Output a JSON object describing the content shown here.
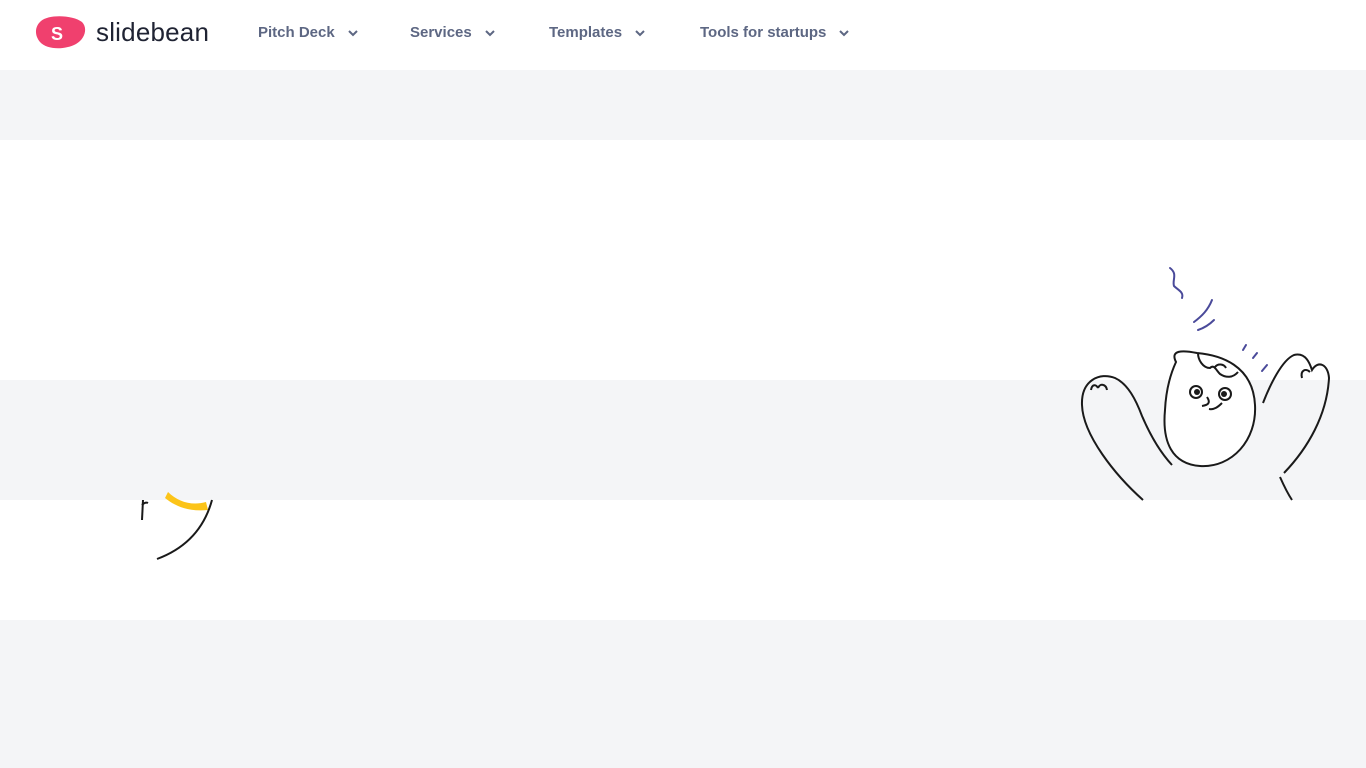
{
  "brand": {
    "name": "slidebean",
    "logo_letter": "S",
    "logo_color": "#f0406e"
  },
  "nav": {
    "items": [
      {
        "label": "Pitch Deck",
        "icon": "chevron-down-icon"
      },
      {
        "label": "Services",
        "icon": "chevron-down-icon"
      },
      {
        "label": "Templates",
        "icon": "chevron-down-icon"
      },
      {
        "label": "Tools for startups",
        "icon": "chevron-down-icon"
      }
    ]
  },
  "colors": {
    "nav_text": "#5d6783",
    "band_background": "#f4f5f7",
    "illustration_accent_blue": "#4a4a9a",
    "illustration_accent_yellow": "#fcc419"
  },
  "illustrations": [
    {
      "name": "character-arms-up-illustration"
    },
    {
      "name": "partial-yellow-illustration"
    }
  ]
}
